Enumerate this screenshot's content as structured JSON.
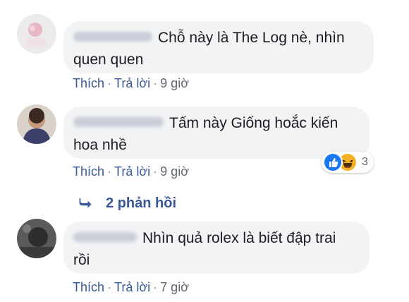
{
  "comments": [
    {
      "text_line1": "Chỗ này là The Log nè, nhìn",
      "text_line2": "quen quen",
      "actions": {
        "like": "Thích",
        "reply": "Trả lời",
        "time": "9 giờ"
      }
    },
    {
      "text_line1": "Tấm này Giống hoắc kiến",
      "text_line2": "hoa nhề",
      "actions": {
        "like": "Thích",
        "reply": "Trả lời",
        "time": "9 giờ"
      },
      "reactions": {
        "icons": [
          "like-icon",
          "haha-icon"
        ],
        "count": "3"
      },
      "replies_label": "2 phản hồi"
    },
    {
      "text_line1": "Nhìn quả rolex là biết đập trai",
      "text_line2": "rồi",
      "actions": {
        "like": "Thích",
        "reply": "Trả lời",
        "time": "7 giờ"
      }
    }
  ],
  "separator": "·",
  "colors": {
    "link": "#385898",
    "bubble": "#f2f3f5",
    "like": "#1877f2",
    "haha": "#f7b125"
  }
}
